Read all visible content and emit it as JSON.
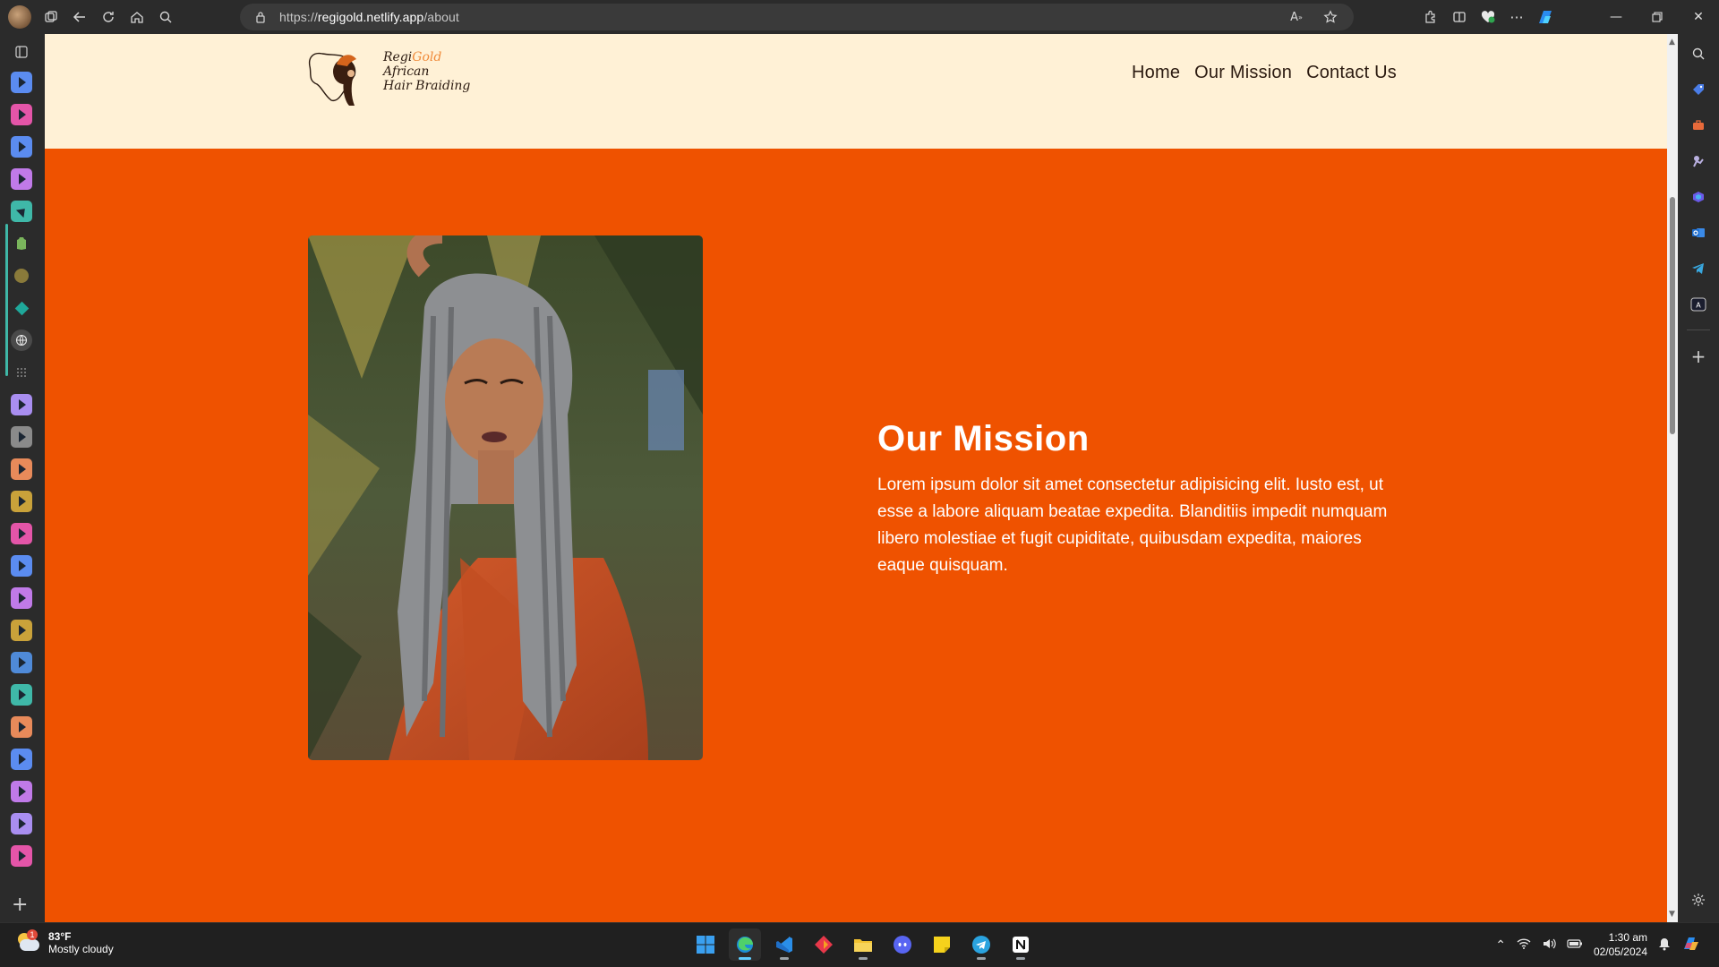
{
  "browser": {
    "url_prefix": "https://",
    "url_host": "regigold.netlify.app",
    "url_path": "/about"
  },
  "site": {
    "logo_line1_a": "Regi",
    "logo_line1_b": "Gold",
    "logo_line2": "African",
    "logo_line3": "Hair Braiding",
    "nav": [
      "Home",
      "Our Mission",
      "Contact Us"
    ]
  },
  "mission": {
    "title": "Our Mission",
    "body": "Lorem ipsum dolor sit amet consectetur adipisicing elit. Iusto est, ut esse a labore aliquam beatae expedita. Blanditiis impedit numquam libero molestiae et fugit cupiditate, quibusdam expedita, maiores eaque quisquam."
  },
  "taskbar": {
    "temperature": "83°F",
    "weather": "Mostly cloudy",
    "weather_badge": "1",
    "time": "1:30 am",
    "date": "02/05/2024"
  },
  "colors": {
    "page_orange": "#ef5200",
    "header_cream": "#fff1d6"
  }
}
